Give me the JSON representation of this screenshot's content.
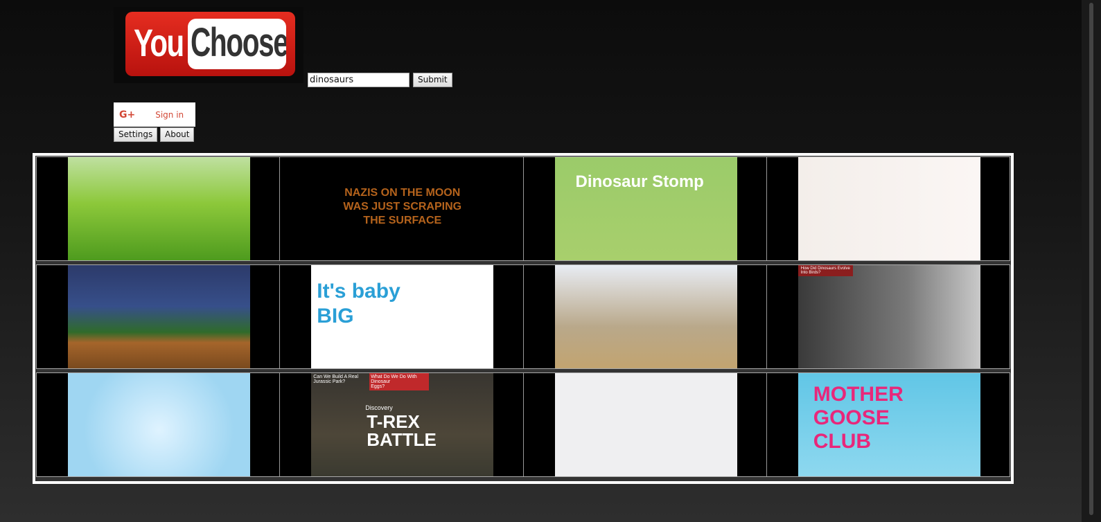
{
  "header": {
    "logo_you": "You",
    "logo_choose": "Choose",
    "search_value": "dinosaurs",
    "submit_label": "Submit"
  },
  "auth": {
    "gplus_icon": "G+",
    "signin_label": "Sign in"
  },
  "nav": {
    "settings_label": "Settings",
    "about_label": "About"
  },
  "videos": [
    {
      "bg": "linear-gradient(#bfe0a0,#8cc83a 45%,#4e9b1e)",
      "text": "",
      "color": "#fff"
    },
    {
      "bg": "#000",
      "text": "NAZIS ON THE MOON\nWAS JUST SCRAPING\nTHE SURFACE",
      "color": "#b5631c"
    },
    {
      "bg": "linear-gradient(#9bcb6a,#a8cf6c)",
      "text": "Dinosaur Stomp",
      "color": "#fff"
    },
    {
      "bg": "linear-gradient(90deg,#f3eeea,#fbf6f4)",
      "text": "",
      "color": "#ff6ea8"
    },
    {
      "bg": "linear-gradient(#2c3a6a,#374f8a 40%,#2f6b2a 65%,#a5652b 75%,#7a4a1e)",
      "text": "",
      "color": "#fff"
    },
    {
      "bg": "#fff",
      "text": "It's baby\nBIG",
      "color": "#2a9fd6"
    },
    {
      "bg": "linear-gradient(#e8ecf3,#b9a88a 60%,#c2a470)",
      "text": "",
      "color": "#fff"
    },
    {
      "bg": "linear-gradient(90deg,#3a3a3a,#7a7a7a 60%,#c9c9c9)",
      "text": "How Did Dinosaurs Evolve\nInto Birds?",
      "color": "#fff"
    },
    {
      "bg": "radial-gradient(circle at 50% 55%,#dff3ff,#9fd6f2 70%)",
      "text": "",
      "color": "#fff"
    },
    {
      "bg": "linear-gradient(#383530,#4d4638 60%,#3a3a30)",
      "text": "Can We Build A Real\nJurassic Park?",
      "text2": "What Do We Do With Dinosaur\nEggs?",
      "text3": "Discovery",
      "text4": "T-REX\nBATTLE",
      "color": "#fff"
    },
    {
      "bg": "#efeff1",
      "text": "",
      "color": "#fff"
    },
    {
      "bg": "linear-gradient(#61c6e6,#8ed8ef)",
      "text": "MOTHER\nGOOSE\nCLUB",
      "color": "#e8277a"
    }
  ]
}
